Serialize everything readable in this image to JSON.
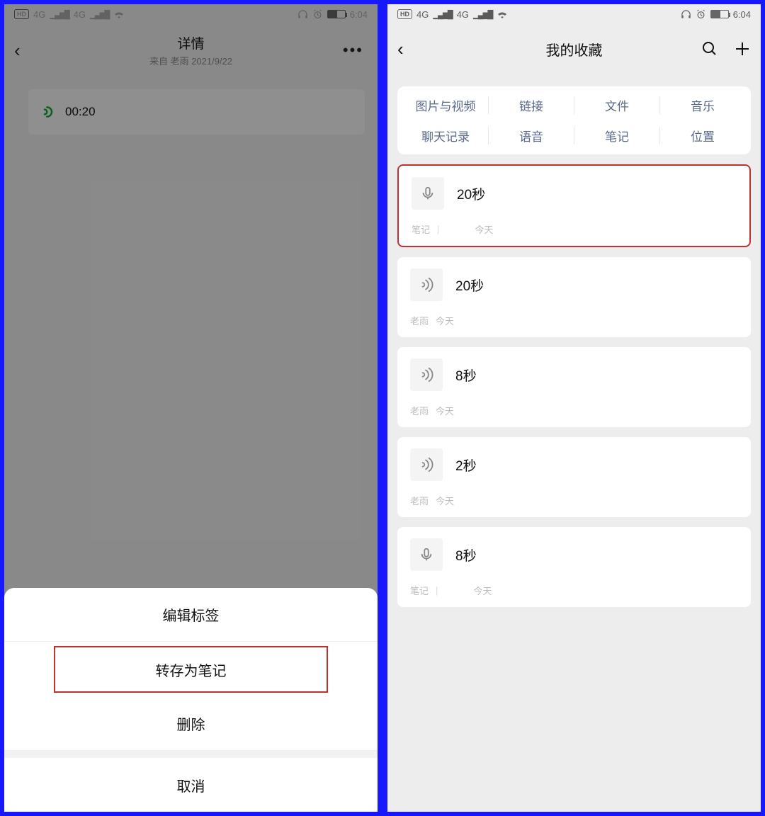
{
  "status": {
    "hd": "HD",
    "net1": "4G",
    "net2": "4G",
    "time": "6:04"
  },
  "left": {
    "title": "详情",
    "subtitle": "来自 老雨 2021/9/22",
    "voice_duration": "00:20",
    "sheet": {
      "edit_tags": "编辑标签",
      "save_as_note": "转存为笔记",
      "delete": "删除",
      "cancel": "取消"
    }
  },
  "right": {
    "title": "我的收藏",
    "categories": {
      "row1": [
        "图片与视频",
        "链接",
        "文件",
        "音乐"
      ],
      "row2": [
        "聊天记录",
        "语音",
        "笔记",
        "位置"
      ]
    },
    "items": [
      {
        "icon": "mic",
        "title": "20秒",
        "meta1": "笔记",
        "meta2": "今天"
      },
      {
        "icon": "sound",
        "title": "20秒",
        "meta1": "老雨",
        "meta2": "今天"
      },
      {
        "icon": "sound",
        "title": "8秒",
        "meta1": "老雨",
        "meta2": "今天"
      },
      {
        "icon": "sound",
        "title": "2秒",
        "meta1": "老雨",
        "meta2": "今天"
      },
      {
        "icon": "mic",
        "title": "8秒",
        "meta1": "笔记",
        "meta2": "今天"
      }
    ]
  }
}
